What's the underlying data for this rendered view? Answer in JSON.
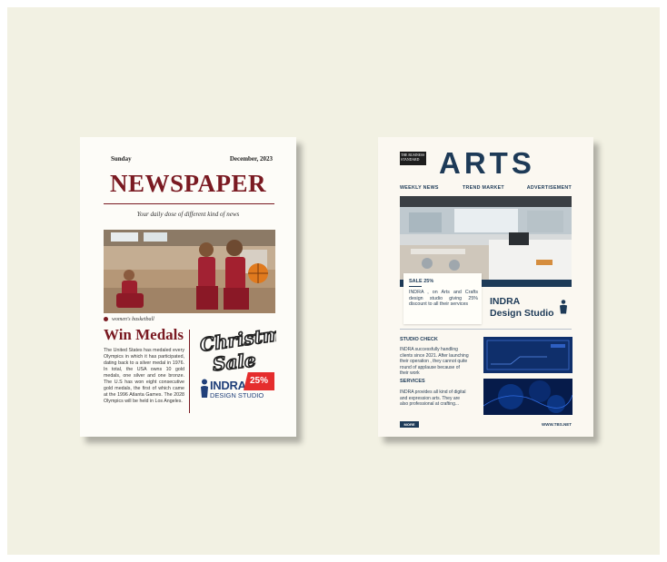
{
  "newspaper": {
    "day": "Sunday",
    "date": "December, 2023",
    "masthead": "NEWSPAPER",
    "tagline": "Your daily dose of different kind of news",
    "photo_caption": "women's basketball",
    "headline": "Win Medals",
    "body": "The United States has medaled every Olympics in which it has participated, dating back to a silver medal in 1976. In total, the USA owns 10 gold medals, one silver and one bronze. The U.S has won eight consecutive gold medals, the first of which came at the 1996 Atlanta Games. The 2028 Olympics will be held in Los Angeles.",
    "promo_title": "Christmas Sale",
    "promo_badge": "25%",
    "brand_name": "INDRA",
    "brand_sub": "DESIGN STUDIO",
    "accent_color": "#7a1a22"
  },
  "arts": {
    "publisher": "THE BUSINESS STANDARD",
    "masthead": "ARTS",
    "nav": [
      "WEEKLY NEWS",
      "TREND MARKET",
      "ADVERTISEMENT"
    ],
    "sale_title": "SALE 25%",
    "sale_text": "INDRA , on Arts and Crafts design studio giving 25% discount to all their services",
    "brand_line1": "INDRA",
    "brand_line2": "Design Studio",
    "section1_title": "STUDIO CHECK",
    "section1_text": "INDRA successfully handling clients since 2021. After launching their operation , they cannot quite round of applause because of their work",
    "section2_title": "SERVICES",
    "section2_text": "INDRA provides all kind of digital and expression arts. They are also professional at crafting...",
    "more_label": "MORE",
    "website": "WWW.TBS.NET",
    "accent_color": "#1d3a57"
  }
}
